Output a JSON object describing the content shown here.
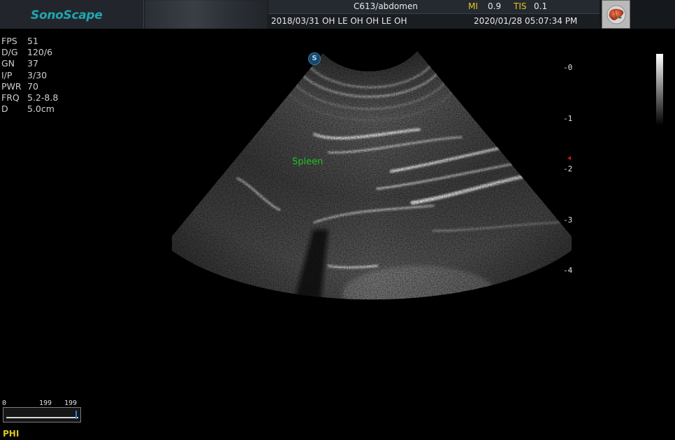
{
  "header": {
    "brand": "SonoScape",
    "probe_preset": "C613/abdomen",
    "mi_label": "MI",
    "mi_value": "0.9",
    "tis_label": "TIS",
    "tis_value": "0.1",
    "exam_info": "2018/03/31  OH LE OH OH LE OH",
    "datetime": "2020/01/28 05:07:34 PM",
    "preset_icon": "liver-organ-icon"
  },
  "params": [
    {
      "key": "FPS",
      "value": "51"
    },
    {
      "key": "D/G",
      "value": "120/6"
    },
    {
      "key": "GN",
      "value": "37"
    },
    {
      "key": "I/P",
      "value": "3/30"
    },
    {
      "key": "PWR",
      "value": "70"
    },
    {
      "key": "FRQ",
      "value": "5.2-8.8"
    },
    {
      "key": "D",
      "value": "5.0cm"
    }
  ],
  "depth_scale": [
    "-0",
    "-1",
    "-2",
    "-3",
    "-4"
  ],
  "image": {
    "orientation_marker": "S",
    "annotation": "Spleen",
    "annotation_color": "#1ec21e"
  },
  "slider": {
    "label_left": "0",
    "label_mid": "199",
    "label_right": "199",
    "position": 0.97
  },
  "mode_label": "PHI"
}
